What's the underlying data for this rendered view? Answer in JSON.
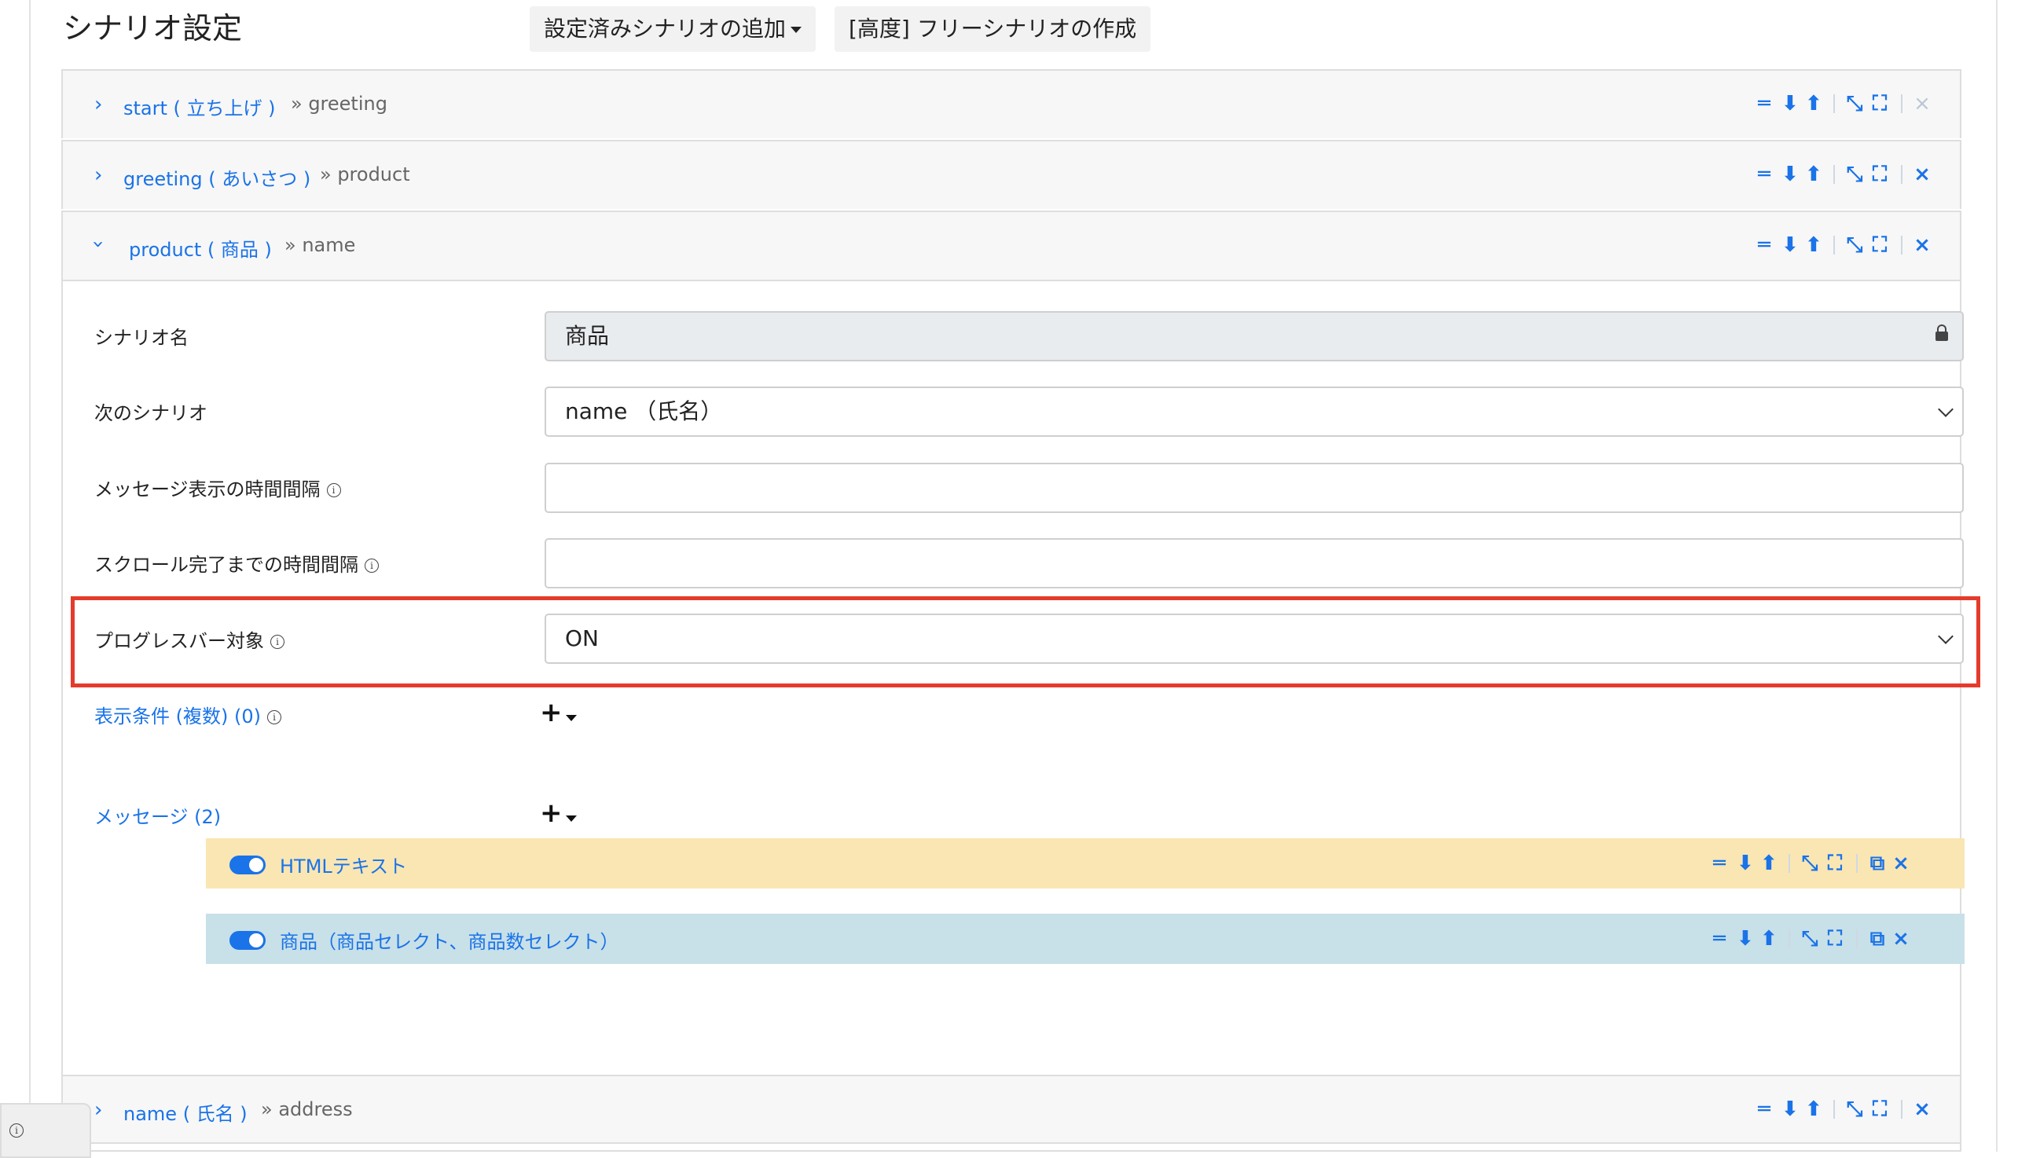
{
  "header": {
    "title": "シナリオ設定",
    "add_button": "設定済みシナリオの追加",
    "free_button": "[高度] フリーシナリオの作成"
  },
  "scenarios": [
    {
      "name": "start ( 立ち上げ )",
      "next": "» greeting",
      "expanded": false
    },
    {
      "name": "greeting ( あいさつ )",
      "next": "» product",
      "expanded": false
    },
    {
      "name": "product ( 商品 )",
      "next": "» name",
      "expanded": true
    },
    {
      "name": "name ( 氏名 )",
      "next": "» address",
      "expanded": false
    }
  ],
  "tools": {
    "reorder": "═",
    "down": "⬇",
    "up": "⬆",
    "collapse": "⤡",
    "expand": "⛶",
    "close": "×",
    "copy": "⧉"
  },
  "form": {
    "scenario_name_label": "シナリオ名",
    "scenario_name_value": "商品",
    "next_scenario_label": "次のシナリオ",
    "next_scenario_value": "name （氏名）",
    "message_interval_label": "メッセージ表示の時間間隔",
    "message_interval_value": "",
    "scroll_interval_label": "スクロール完了までの時間間隔",
    "scroll_interval_value": "",
    "progress_label": "プログレスバー対象",
    "progress_value": "ON",
    "info_symbol": "i"
  },
  "conditions": {
    "label": "表示条件 (複数) (0)",
    "add": "+"
  },
  "messages": {
    "label": "メッセージ (2)",
    "add": "+",
    "items": [
      {
        "label": "HTMLテキスト",
        "enabled": true,
        "bg": "#f9e6b3"
      },
      {
        "label": "商品（商品セレクト、商品数セレクト）",
        "enabled": true,
        "bg": "#c8e0e8"
      }
    ]
  },
  "colors": {
    "accent": "#1a73e8",
    "highlight": "#e53b2c"
  }
}
